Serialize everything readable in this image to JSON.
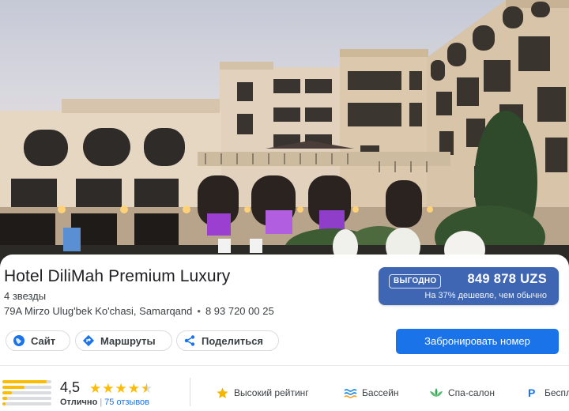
{
  "hotel": {
    "name": "Hotel DiliMah Premium Luxury",
    "class": "4 звезды",
    "address": "79A Mirzo Ulug'bek Ko'chasi, Samarqand",
    "separator": "•",
    "phone": "8 93 720 00 25"
  },
  "deal": {
    "badge": "ВЫГОДНО",
    "price": "849 878 UZS",
    "note": "На 37% дешевле, чем обычно",
    "color": "#3f66b3"
  },
  "actions": {
    "website": "Сайт",
    "routes": "Маршруты",
    "share": "Поделиться",
    "book": "Забронировать номер"
  },
  "rating": {
    "score": "4,5",
    "stars_value": 4.5,
    "stars": "★★★★",
    "half_star": "★",
    "word": "Отлично",
    "divider": "|",
    "reviews": "75 отзывов",
    "distribution": [
      0.9,
      0.45,
      0.2,
      0.1,
      0.06
    ]
  },
  "amenities": [
    {
      "label": "Высокий рейтинг",
      "icon": "star-icon"
    },
    {
      "label": "Бассейн",
      "icon": "pool-icon"
    },
    {
      "label": "Спа-салон",
      "icon": "spa-icon"
    },
    {
      "label": "Беспл",
      "icon": "parking-icon"
    }
  ],
  "colors": {
    "primary": "#1a73e8",
    "star": "#fbbc04"
  }
}
